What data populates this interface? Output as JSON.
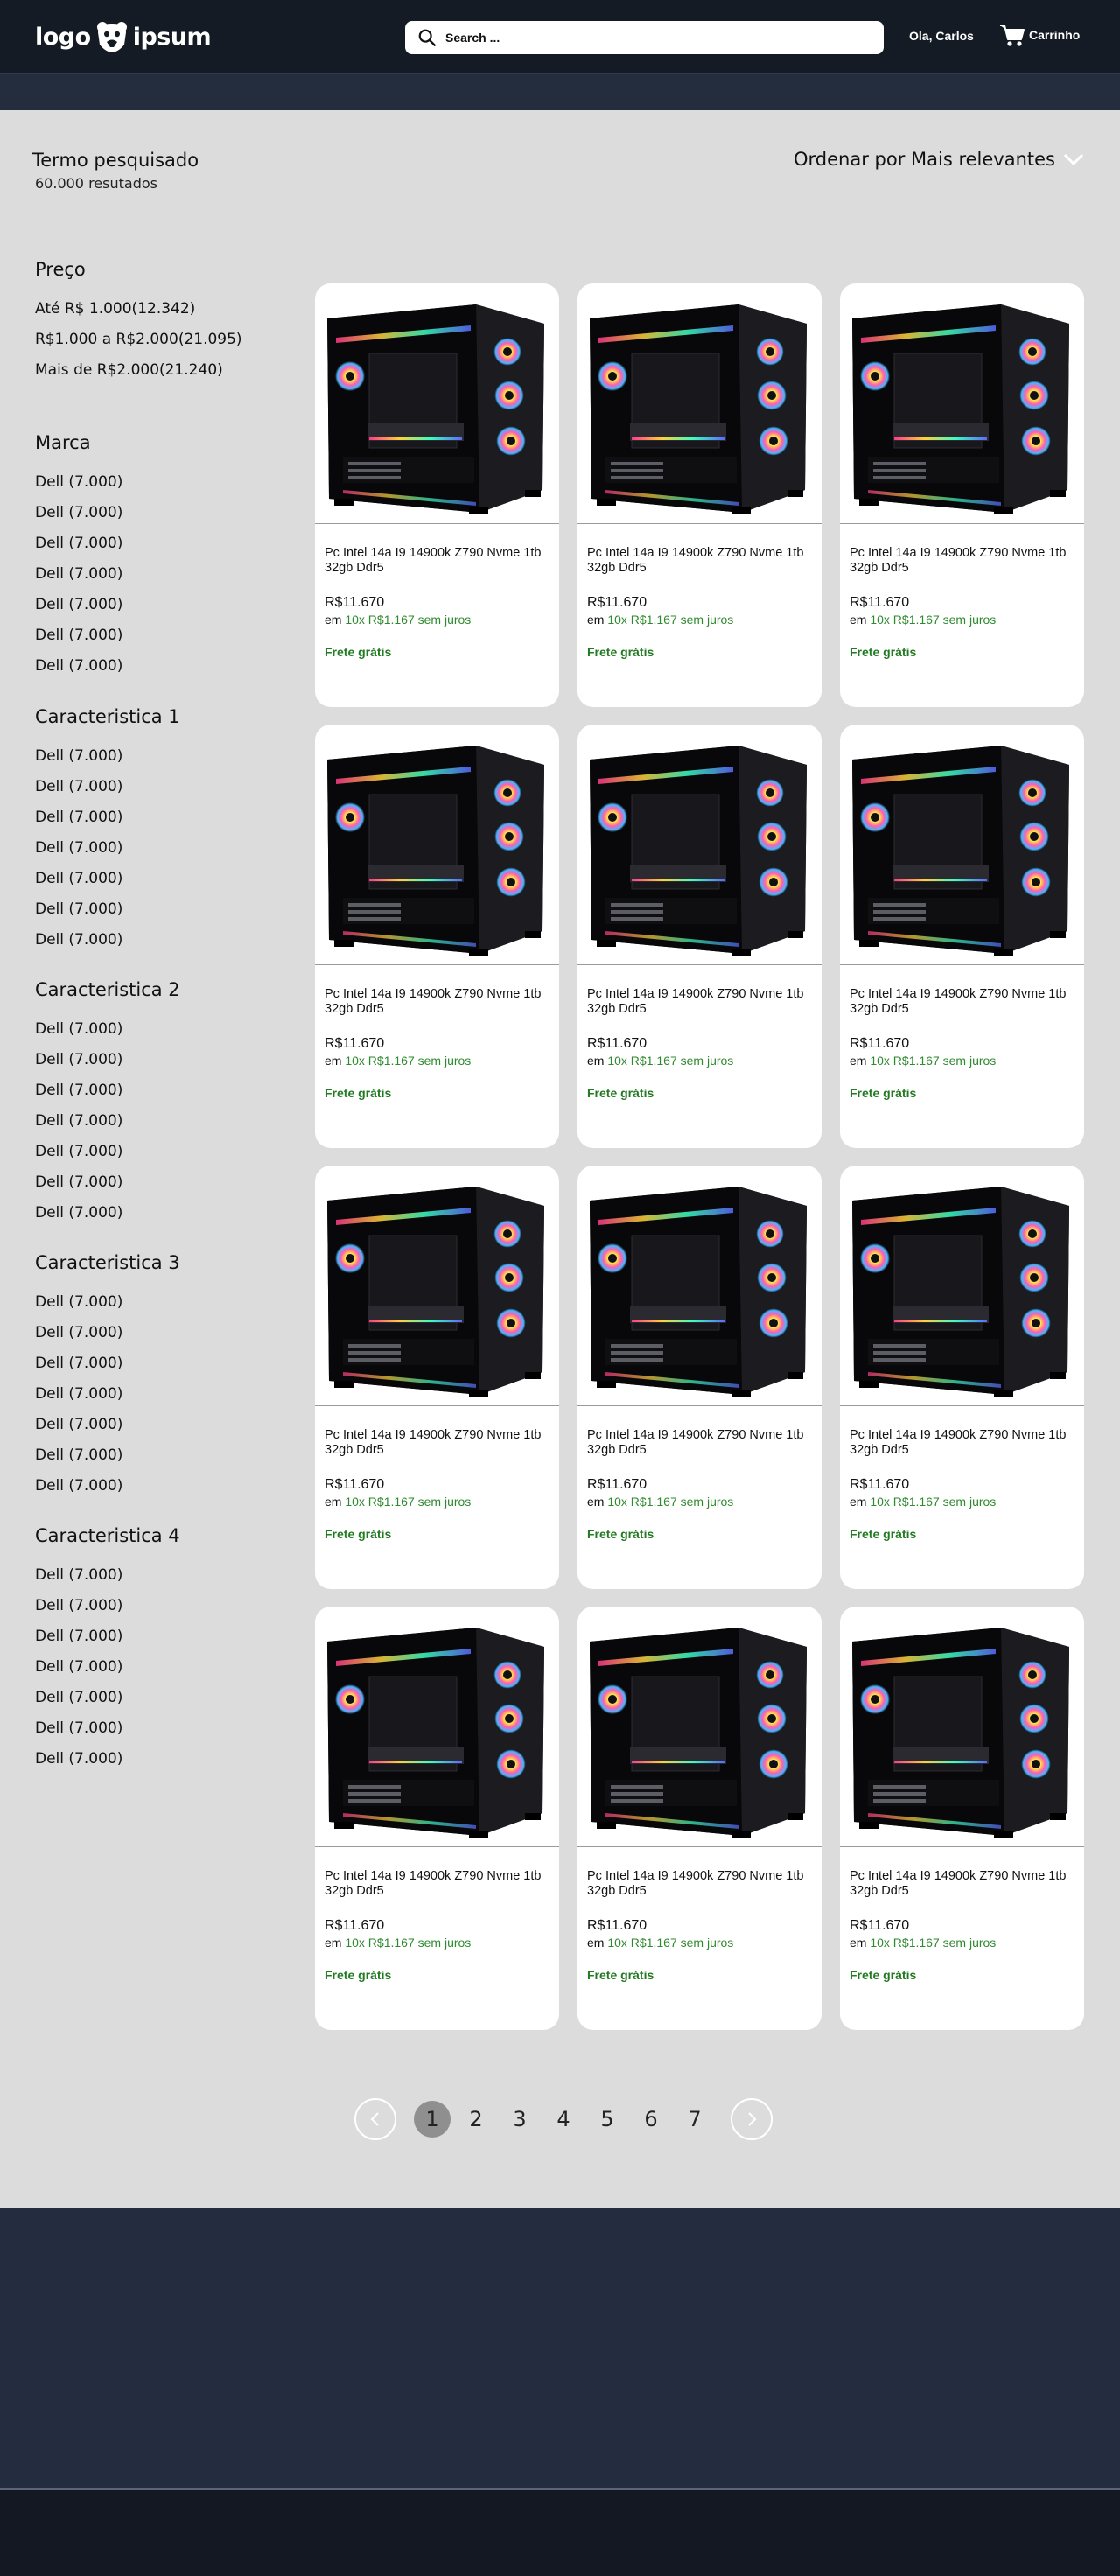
{
  "header": {
    "logo_left": "logo",
    "logo_right": "ipsum",
    "search_placeholder": "Search ...",
    "greeting": "Ola, Carlos",
    "cart_label": "Carrinho"
  },
  "results": {
    "term_label": "Termo pesquisado",
    "count_label": "60.000 resutados",
    "sort_label": "Ordenar por Mais relevantes"
  },
  "filters": [
    {
      "title": "Preço",
      "items": [
        "Até R$ 1.000(12.342)",
        "R$1.000 a R$2.000(21.095)",
        "Mais de R$2.000(21.240)"
      ]
    },
    {
      "title": "Marca",
      "items": [
        "Dell (7.000)",
        "Dell (7.000)",
        "Dell (7.000)",
        "Dell (7.000)",
        "Dell (7.000)",
        "Dell (7.000)",
        "Dell (7.000)"
      ]
    },
    {
      "title": "Caracteristica 1",
      "items": [
        "Dell (7.000)",
        "Dell (7.000)",
        "Dell (7.000)",
        "Dell (7.000)",
        "Dell (7.000)",
        "Dell (7.000)",
        "Dell (7.000)"
      ]
    },
    {
      "title": "Caracteristica 2",
      "items": [
        "Dell (7.000)",
        "Dell (7.000)",
        "Dell (7.000)",
        "Dell (7.000)",
        "Dell (7.000)",
        "Dell (7.000)",
        "Dell (7.000)"
      ]
    },
    {
      "title": "Caracteristica 3",
      "items": [
        "Dell (7.000)",
        "Dell (7.000)",
        "Dell (7.000)",
        "Dell (7.000)",
        "Dell (7.000)",
        "Dell (7.000)",
        "Dell (7.000)"
      ]
    },
    {
      "title": "Caracteristica 4",
      "items": [
        "Dell (7.000)",
        "Dell (7.000)",
        "Dell (7.000)",
        "Dell (7.000)",
        "Dell (7.000)",
        "Dell (7.000)",
        "Dell (7.000)"
      ]
    }
  ],
  "product": {
    "name": "Pc Intel 14a I9 14900k Z790 Nvme 1tb 32gb Ddr5",
    "price": "R$11.670",
    "installment_prefix": "em ",
    "installment": "10x R$1.167 sem juros",
    "shipping": "Frete grátis"
  },
  "products_count": 12,
  "pagination": {
    "pages": [
      "1",
      "2",
      "3",
      "4",
      "5",
      "6",
      "7"
    ],
    "current": "1"
  },
  "colors": {
    "header": "#141b24",
    "accent_green": "#227a22",
    "background": "#dcdcdc",
    "footer": "#242d3f"
  }
}
